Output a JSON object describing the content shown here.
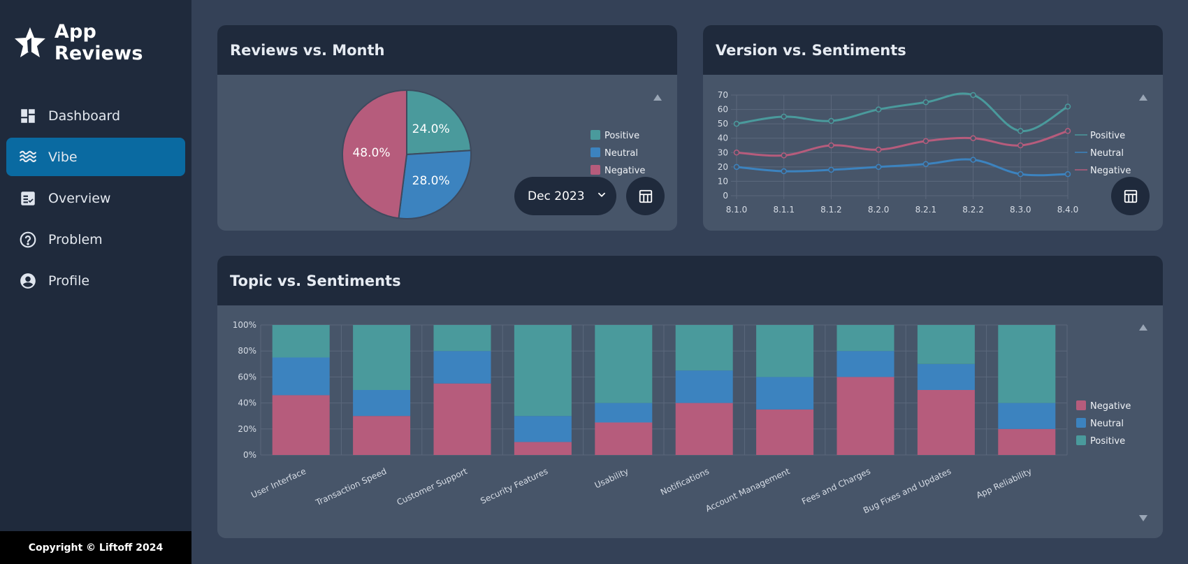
{
  "app": {
    "title": "App Reviews"
  },
  "sidebar": {
    "items": [
      {
        "label": "Dashboard",
        "icon": "dashboard-icon",
        "active": false
      },
      {
        "label": "Vibe",
        "icon": "waves-icon",
        "active": true
      },
      {
        "label": "Overview",
        "icon": "checklist-icon",
        "active": false
      },
      {
        "label": "Problem",
        "icon": "help-circle-icon",
        "active": false
      },
      {
        "label": "Profile",
        "icon": "account-circle-icon",
        "active": false
      }
    ],
    "footer": "Copyright © Liftoff 2024"
  },
  "colors": {
    "positive": "#4a9a9c",
    "neutral": "#3c83bf",
    "negative": "#b65c7c",
    "accent": "#0a6aa1"
  },
  "cards": {
    "reviews": {
      "title": "Reviews vs. Month",
      "month_value": "Dec 2023"
    },
    "version": {
      "title": "Version vs. Sentiments"
    },
    "topic": {
      "title": "Topic vs. Sentiments"
    }
  },
  "chart_data": [
    {
      "type": "pie",
      "title": "Reviews vs. Month",
      "labels": [
        "Positive",
        "Neutral",
        "Negative"
      ],
      "values": [
        24.0,
        28.0,
        48.0
      ],
      "value_labels": [
        "24.0%",
        "28.0%",
        "48.0%"
      ],
      "legend": "right"
    },
    {
      "type": "line",
      "title": "Version vs. Sentiments",
      "x": [
        "8.1.0",
        "8.1.1",
        "8.1.2",
        "8.2.0",
        "8.2.1",
        "8.2.2",
        "8.3.0",
        "8.4.0"
      ],
      "series": [
        {
          "name": "Positive",
          "values": [
            50,
            55,
            52,
            60,
            65,
            70,
            45,
            62
          ]
        },
        {
          "name": "Neutral",
          "values": [
            20,
            17,
            18,
            20,
            22,
            25,
            15,
            15
          ]
        },
        {
          "name": "Negative",
          "values": [
            30,
            28,
            35,
            32,
            38,
            40,
            35,
            45
          ]
        }
      ],
      "ylim": [
        0,
        70
      ],
      "yticks": [
        "0",
        "10",
        "20",
        "30",
        "40",
        "50",
        "60",
        "70"
      ],
      "grid": true,
      "legend": "right"
    },
    {
      "type": "bar",
      "stacked": true,
      "title": "Topic vs. Sentiments",
      "categories": [
        "User Interface",
        "Transaction Speed",
        "Customer Support",
        "Security Features",
        "Usability",
        "Notifications",
        "Account Management",
        "Fees and Charges",
        "Bug Fixes and Updates",
        "App Reliability"
      ],
      "series": [
        {
          "name": "Negative",
          "values": [
            46,
            30,
            55,
            10,
            25,
            40,
            35,
            60,
            50,
            20
          ]
        },
        {
          "name": "Neutral",
          "values": [
            29,
            20,
            25,
            20,
            15,
            25,
            25,
            20,
            20,
            20
          ]
        },
        {
          "name": "Positive",
          "values": [
            25,
            50,
            20,
            70,
            60,
            35,
            40,
            20,
            30,
            60
          ]
        }
      ],
      "ylim": [
        0,
        100
      ],
      "yticks": [
        "0%",
        "20%",
        "40%",
        "60%",
        "80%",
        "100%"
      ],
      "grid": true,
      "legend": "right"
    }
  ]
}
